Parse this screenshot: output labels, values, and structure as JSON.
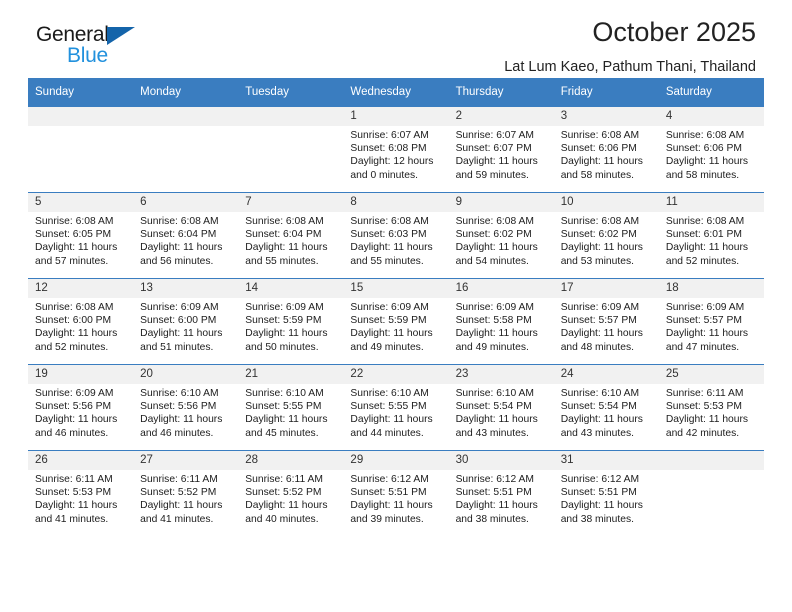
{
  "brand": {
    "name_top": "General",
    "name_bottom": "Blue",
    "accent_color": "#2291dd",
    "triangle_color": "#1464aa"
  },
  "header": {
    "title": "October 2025",
    "subtitle": "Lat Lum Kaeo, Pathum Thani, Thailand",
    "header_bg": "#3a7dc0"
  },
  "weekday_headers": [
    "Sunday",
    "Monday",
    "Tuesday",
    "Wednesday",
    "Thursday",
    "Friday",
    "Saturday"
  ],
  "labels": {
    "sunrise": "Sunrise:",
    "sunset": "Sunset:",
    "daylight": "Daylight:"
  },
  "weeks": [
    [
      {
        "day": "",
        "empty": true
      },
      {
        "day": "",
        "empty": true
      },
      {
        "day": "",
        "empty": true
      },
      {
        "day": "1",
        "sunrise": "Sunrise: 6:07 AM",
        "sunset": "Sunset: 6:08 PM",
        "daylight1": "Daylight: 12 hours",
        "daylight2": "and 0 minutes."
      },
      {
        "day": "2",
        "sunrise": "Sunrise: 6:07 AM",
        "sunset": "Sunset: 6:07 PM",
        "daylight1": "Daylight: 11 hours",
        "daylight2": "and 59 minutes."
      },
      {
        "day": "3",
        "sunrise": "Sunrise: 6:08 AM",
        "sunset": "Sunset: 6:06 PM",
        "daylight1": "Daylight: 11 hours",
        "daylight2": "and 58 minutes."
      },
      {
        "day": "4",
        "sunrise": "Sunrise: 6:08 AM",
        "sunset": "Sunset: 6:06 PM",
        "daylight1": "Daylight: 11 hours",
        "daylight2": "and 58 minutes."
      }
    ],
    [
      {
        "day": "5",
        "sunrise": "Sunrise: 6:08 AM",
        "sunset": "Sunset: 6:05 PM",
        "daylight1": "Daylight: 11 hours",
        "daylight2": "and 57 minutes."
      },
      {
        "day": "6",
        "sunrise": "Sunrise: 6:08 AM",
        "sunset": "Sunset: 6:04 PM",
        "daylight1": "Daylight: 11 hours",
        "daylight2": "and 56 minutes."
      },
      {
        "day": "7",
        "sunrise": "Sunrise: 6:08 AM",
        "sunset": "Sunset: 6:04 PM",
        "daylight1": "Daylight: 11 hours",
        "daylight2": "and 55 minutes."
      },
      {
        "day": "8",
        "sunrise": "Sunrise: 6:08 AM",
        "sunset": "Sunset: 6:03 PM",
        "daylight1": "Daylight: 11 hours",
        "daylight2": "and 55 minutes."
      },
      {
        "day": "9",
        "sunrise": "Sunrise: 6:08 AM",
        "sunset": "Sunset: 6:02 PM",
        "daylight1": "Daylight: 11 hours",
        "daylight2": "and 54 minutes."
      },
      {
        "day": "10",
        "sunrise": "Sunrise: 6:08 AM",
        "sunset": "Sunset: 6:02 PM",
        "daylight1": "Daylight: 11 hours",
        "daylight2": "and 53 minutes."
      },
      {
        "day": "11",
        "sunrise": "Sunrise: 6:08 AM",
        "sunset": "Sunset: 6:01 PM",
        "daylight1": "Daylight: 11 hours",
        "daylight2": "and 52 minutes."
      }
    ],
    [
      {
        "day": "12",
        "sunrise": "Sunrise: 6:08 AM",
        "sunset": "Sunset: 6:00 PM",
        "daylight1": "Daylight: 11 hours",
        "daylight2": "and 52 minutes."
      },
      {
        "day": "13",
        "sunrise": "Sunrise: 6:09 AM",
        "sunset": "Sunset: 6:00 PM",
        "daylight1": "Daylight: 11 hours",
        "daylight2": "and 51 minutes."
      },
      {
        "day": "14",
        "sunrise": "Sunrise: 6:09 AM",
        "sunset": "Sunset: 5:59 PM",
        "daylight1": "Daylight: 11 hours",
        "daylight2": "and 50 minutes."
      },
      {
        "day": "15",
        "sunrise": "Sunrise: 6:09 AM",
        "sunset": "Sunset: 5:59 PM",
        "daylight1": "Daylight: 11 hours",
        "daylight2": "and 49 minutes."
      },
      {
        "day": "16",
        "sunrise": "Sunrise: 6:09 AM",
        "sunset": "Sunset: 5:58 PM",
        "daylight1": "Daylight: 11 hours",
        "daylight2": "and 49 minutes."
      },
      {
        "day": "17",
        "sunrise": "Sunrise: 6:09 AM",
        "sunset": "Sunset: 5:57 PM",
        "daylight1": "Daylight: 11 hours",
        "daylight2": "and 48 minutes."
      },
      {
        "day": "18",
        "sunrise": "Sunrise: 6:09 AM",
        "sunset": "Sunset: 5:57 PM",
        "daylight1": "Daylight: 11 hours",
        "daylight2": "and 47 minutes."
      }
    ],
    [
      {
        "day": "19",
        "sunrise": "Sunrise: 6:09 AM",
        "sunset": "Sunset: 5:56 PM",
        "daylight1": "Daylight: 11 hours",
        "daylight2": "and 46 minutes."
      },
      {
        "day": "20",
        "sunrise": "Sunrise: 6:10 AM",
        "sunset": "Sunset: 5:56 PM",
        "daylight1": "Daylight: 11 hours",
        "daylight2": "and 46 minutes."
      },
      {
        "day": "21",
        "sunrise": "Sunrise: 6:10 AM",
        "sunset": "Sunset: 5:55 PM",
        "daylight1": "Daylight: 11 hours",
        "daylight2": "and 45 minutes."
      },
      {
        "day": "22",
        "sunrise": "Sunrise: 6:10 AM",
        "sunset": "Sunset: 5:55 PM",
        "daylight1": "Daylight: 11 hours",
        "daylight2": "and 44 minutes."
      },
      {
        "day": "23",
        "sunrise": "Sunrise: 6:10 AM",
        "sunset": "Sunset: 5:54 PM",
        "daylight1": "Daylight: 11 hours",
        "daylight2": "and 43 minutes."
      },
      {
        "day": "24",
        "sunrise": "Sunrise: 6:10 AM",
        "sunset": "Sunset: 5:54 PM",
        "daylight1": "Daylight: 11 hours",
        "daylight2": "and 43 minutes."
      },
      {
        "day": "25",
        "sunrise": "Sunrise: 6:11 AM",
        "sunset": "Sunset: 5:53 PM",
        "daylight1": "Daylight: 11 hours",
        "daylight2": "and 42 minutes."
      }
    ],
    [
      {
        "day": "26",
        "sunrise": "Sunrise: 6:11 AM",
        "sunset": "Sunset: 5:53 PM",
        "daylight1": "Daylight: 11 hours",
        "daylight2": "and 41 minutes."
      },
      {
        "day": "27",
        "sunrise": "Sunrise: 6:11 AM",
        "sunset": "Sunset: 5:52 PM",
        "daylight1": "Daylight: 11 hours",
        "daylight2": "and 41 minutes."
      },
      {
        "day": "28",
        "sunrise": "Sunrise: 6:11 AM",
        "sunset": "Sunset: 5:52 PM",
        "daylight1": "Daylight: 11 hours",
        "daylight2": "and 40 minutes."
      },
      {
        "day": "29",
        "sunrise": "Sunrise: 6:12 AM",
        "sunset": "Sunset: 5:51 PM",
        "daylight1": "Daylight: 11 hours",
        "daylight2": "and 39 minutes."
      },
      {
        "day": "30",
        "sunrise": "Sunrise: 6:12 AM",
        "sunset": "Sunset: 5:51 PM",
        "daylight1": "Daylight: 11 hours",
        "daylight2": "and 38 minutes."
      },
      {
        "day": "31",
        "sunrise": "Sunrise: 6:12 AM",
        "sunset": "Sunset: 5:51 PM",
        "daylight1": "Daylight: 11 hours",
        "daylight2": "and 38 minutes."
      },
      {
        "day": "",
        "empty": true
      }
    ]
  ]
}
